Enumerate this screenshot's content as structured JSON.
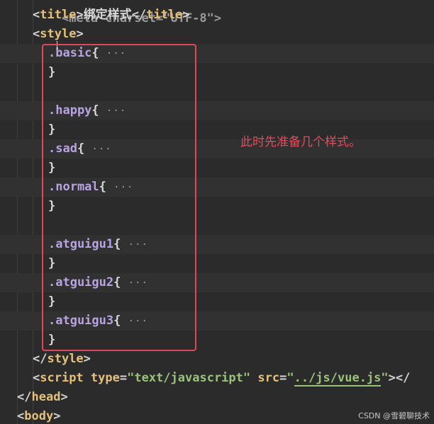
{
  "code": {
    "line0": {
      "text": "<meta charset=\"UTF-8\">"
    },
    "line1": {
      "open": "<",
      "tag": "title",
      "close": ">",
      "content": "绑定样式",
      "end_open": "</",
      "end_tag": "title",
      "end_close": ">"
    },
    "line2": {
      "open": "<",
      "tag": "style",
      "close": ">"
    },
    "rules": [
      {
        "selector": ".basic",
        "brace_open": "{",
        "ellipsis": "···",
        "brace_close": "}"
      },
      {
        "selector": ".happy",
        "brace_open": "{",
        "ellipsis": "···",
        "brace_close": "}"
      },
      {
        "selector": ".sad",
        "brace_open": "{",
        "ellipsis": "···",
        "brace_close": "}"
      },
      {
        "selector": ".normal",
        "brace_open": "{",
        "ellipsis": "···",
        "brace_close": "}"
      },
      {
        "selector": ".atguigu1",
        "brace_open": "{",
        "ellipsis": "···",
        "brace_close": "}"
      },
      {
        "selector": ".atguigu2",
        "brace_open": "{",
        "ellipsis": "···",
        "brace_close": "}"
      },
      {
        "selector": ".atguigu3",
        "brace_open": "{",
        "ellipsis": "···",
        "brace_close": "}"
      }
    ],
    "style_end": {
      "open": "</",
      "tag": "style",
      "close": ">"
    },
    "script_line": {
      "open": "<",
      "tag": "script",
      "attr1_name": "type",
      "eq1": "=",
      "attr1_value": "\"text/javascript\"",
      "attr2_name": "src",
      "eq2": "=",
      "attr2_quote_open": "\"",
      "attr2_value": "../js/vue.js",
      "attr2_quote_close": "\"",
      "tail": "></"
    },
    "head_end": {
      "open": "</",
      "tag": "head",
      "close": ">"
    },
    "body_start": {
      "open": "<",
      "tag": "body",
      "close": ">"
    }
  },
  "annotation": {
    "note": "此时先准备几个样式。",
    "box_color": "#e0485a"
  },
  "watermark": "CSDN @雪碧聊技术",
  "colors": {
    "background": "#2b2b2b",
    "tag": "#e5c07b",
    "string": "#98c379",
    "selector": "#b9a3e3",
    "annotation": "#e8495c"
  }
}
